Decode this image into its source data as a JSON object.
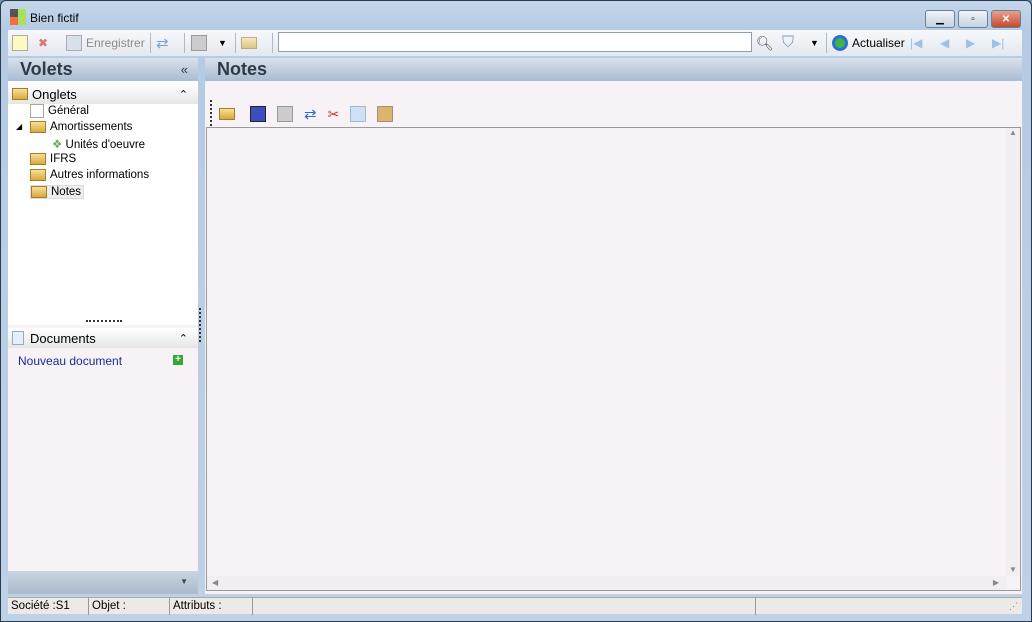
{
  "window": {
    "title": "Bien fictif"
  },
  "toolbar": {
    "save_label": "Enregistrer",
    "refresh_label": "Actualiser",
    "search_value": ""
  },
  "left": {
    "title": "Volets",
    "collapse": "«",
    "onglets": "Onglets",
    "documents": "Documents",
    "new_document": "Nouveau document",
    "tree": [
      {
        "label": "Général"
      },
      {
        "label": "Amortissements"
      },
      {
        "label": "Unités d'oeuvre"
      },
      {
        "label": "IFRS"
      },
      {
        "label": "Autres informations"
      },
      {
        "label": "Notes"
      }
    ]
  },
  "main": {
    "title": "Notes"
  },
  "status": {
    "societe": "Société :S1",
    "objet": "Objet :",
    "attributs": "Attributs :"
  }
}
